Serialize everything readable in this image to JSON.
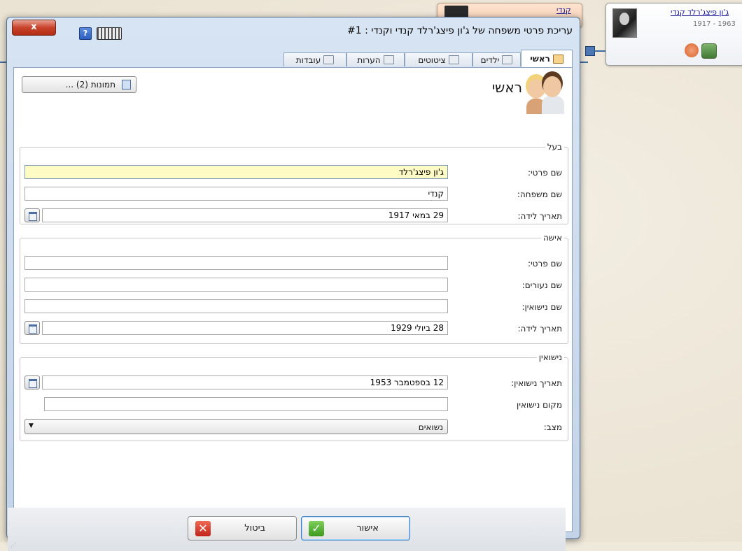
{
  "tree": {
    "main_card": {
      "name": "ג'ון פיצג'רלד קנדי",
      "dates": "1917 - 1963"
    },
    "top_card": {
      "name": "קנדי"
    }
  },
  "dialog": {
    "title": "עריכת פרטי משפחה של ג'ון פיצג'רלד קנדי וקנדי : #1",
    "close_label": "x",
    "help_label": "?",
    "tabs": [
      {
        "label": "ראשי",
        "icon": "couple-icon",
        "active": true
      },
      {
        "label": "ילדים",
        "icon": "children-icon"
      },
      {
        "label": "ציטוטים",
        "icon": "citations-icon"
      },
      {
        "label": "הערות",
        "icon": "notes-icon"
      },
      {
        "label": "עובדות",
        "icon": "facts-icon"
      }
    ],
    "page_title": "ראשי",
    "photos_button": "תמונות (2) ...",
    "husband": {
      "legend": "בעל",
      "first_name_label": "שם פרטי:",
      "first_name": "ג'ון פיצג'רלד",
      "last_name_label": "שם משפחה:",
      "last_name": "קנדי",
      "birth_label": "תאריך לידה:",
      "birth_date": "29 במאי 1917"
    },
    "wife": {
      "legend": "אישה",
      "first_name_label": "שם פרטי:",
      "first_name": "",
      "maiden_label": "שם נעורים:",
      "maiden_name": "",
      "married_label": "שם נישואין:",
      "married_name": "",
      "birth_label": "תאריך לידה:",
      "birth_date": "28 ביולי 1929"
    },
    "marriage": {
      "legend": "נישואין",
      "date_label": "תאריך נישואין:",
      "date": "12 בספטמבר 1953",
      "place_label": "מקום נישואין",
      "place": "",
      "status_label": "מצב:",
      "status": "נשואים"
    },
    "ok_label": "אישור",
    "cancel_label": "ביטול"
  }
}
